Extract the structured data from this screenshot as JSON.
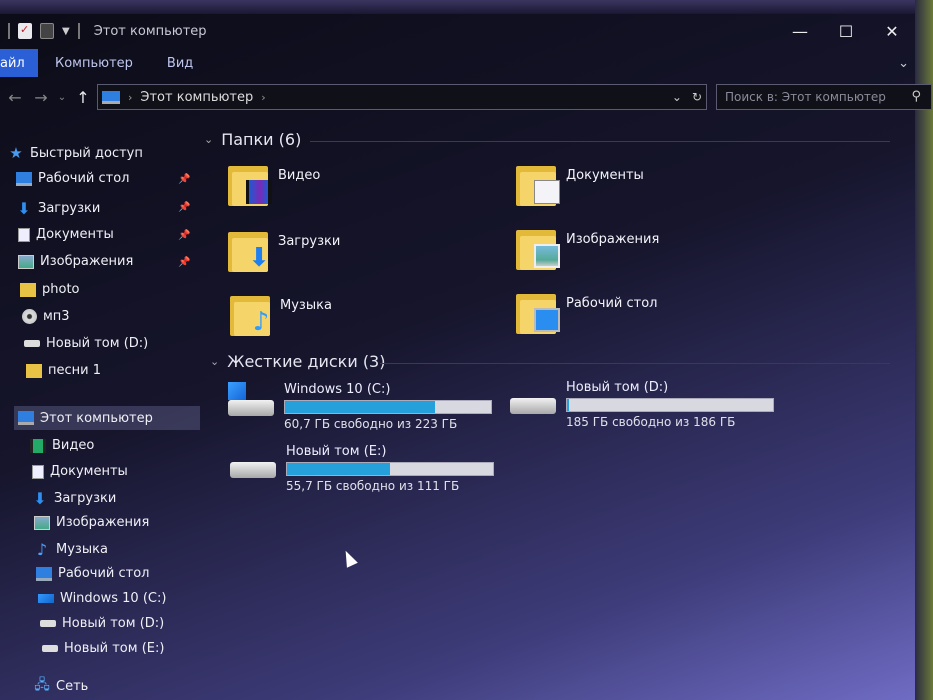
{
  "window": {
    "title": "Этот компьютер",
    "controls": {
      "minimize": "—",
      "maximize": "☐",
      "close": "✕"
    }
  },
  "ribbon": {
    "tabs": [
      "айл",
      "Компьютер",
      "Вид"
    ],
    "expand_icon": "⌄"
  },
  "address": {
    "path": "Этот компьютер",
    "search_placeholder": "Поиск в: Этот компьютер"
  },
  "sidebar": {
    "quick_access": "Быстрый доступ",
    "pinned": [
      {
        "label": "Рабочий стол",
        "icon": "desktop-icon"
      },
      {
        "label": "Загрузки",
        "icon": "downloads-icon"
      },
      {
        "label": "Документы",
        "icon": "documents-icon"
      },
      {
        "label": "Изображения",
        "icon": "pictures-icon"
      }
    ],
    "recent": [
      {
        "label": "photo",
        "icon": "folder-icon"
      },
      {
        "label": "мп3",
        "icon": "cd-icon"
      },
      {
        "label": "Новый том (D:)",
        "icon": "drive-icon"
      },
      {
        "label": "песни 1",
        "icon": "folder-icon"
      }
    ],
    "this_pc": "Этот компьютер",
    "pc_items": [
      {
        "label": "Видео",
        "icon": "videos-icon"
      },
      {
        "label": "Документы",
        "icon": "documents-icon"
      },
      {
        "label": "Загрузки",
        "icon": "downloads-icon"
      },
      {
        "label": "Изображения",
        "icon": "pictures-icon"
      },
      {
        "label": "Музыка",
        "icon": "music-icon"
      },
      {
        "label": "Рабочий стол",
        "icon": "desktop-icon"
      },
      {
        "label": "Windows 10 (C:)",
        "icon": "windows-drive-icon"
      },
      {
        "label": "Новый том (D:)",
        "icon": "drive-icon"
      },
      {
        "label": "Новый том (E:)",
        "icon": "drive-icon"
      }
    ],
    "network": "Сеть"
  },
  "main": {
    "folders_header": "Папки (6)",
    "folders": [
      {
        "label": "Видео",
        "icon": "videos-folder-icon"
      },
      {
        "label": "Документы",
        "icon": "documents-folder-icon"
      },
      {
        "label": "Загрузки",
        "icon": "downloads-folder-icon"
      },
      {
        "label": "Изображения",
        "icon": "pictures-folder-icon"
      },
      {
        "label": "Музыка",
        "icon": "music-folder-icon"
      },
      {
        "label": "Рабочий стол",
        "icon": "desktop-folder-icon"
      }
    ],
    "drives_header": "Жесткие диски (3)",
    "drives": [
      {
        "name": "Windows 10 (C:)",
        "free": "60,7 ГБ свободно из 223 ГБ",
        "used_fraction": 0.73,
        "system": true
      },
      {
        "name": "Новый том (D:)",
        "free": "185 ГБ свободно из 186 ГБ",
        "used_fraction": 0.01,
        "system": false
      },
      {
        "name": "Новый том (E:)",
        "free": "55,7 ГБ свободно из 111 ГБ",
        "used_fraction": 0.5,
        "system": false
      }
    ]
  }
}
